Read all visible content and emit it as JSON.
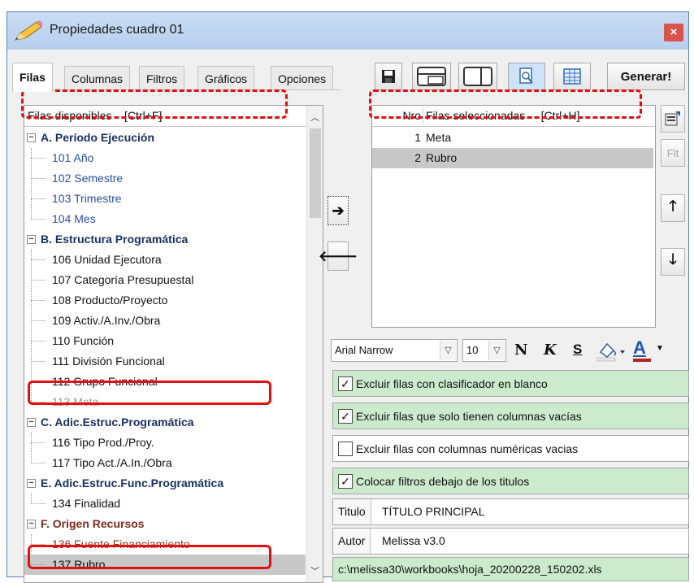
{
  "window": {
    "title": "Propiedades cuadro 01",
    "close_glyph": "×"
  },
  "tabs": [
    {
      "label": "Filas",
      "active": true
    },
    {
      "label": "Columnas",
      "active": false
    },
    {
      "label": "Filtros",
      "active": false
    },
    {
      "label": "Gráficos",
      "active": false
    },
    {
      "label": "Opciones",
      "active": false
    }
  ],
  "toolbar": {
    "icons": [
      "save-icon",
      "layout-rows-icon",
      "layout-columns-icon",
      "preview-icon",
      "grid-icon"
    ],
    "generate_label": "Generar!"
  },
  "available": {
    "header": "Filas disponibles    [Ctrl+F]",
    "groups": [
      {
        "label": "A. Período Ejecución",
        "color": "#17305f",
        "items": [
          "101 Año",
          "102 Semestre",
          "103 Trimestre",
          "104 Mes"
        ]
      },
      {
        "label": "B. Estructura Programática",
        "color": "#17305f",
        "items": [
          "106 Unidad Ejecutora",
          "107 Categoría Presupuestal",
          "108 Producto/Proyecto",
          "109 Activ./A.Inv./Obra",
          "110 Función",
          "111 División Funcional",
          "112 Grupo Funcional",
          "113 Meta"
        ]
      },
      {
        "label": "C. Adic.Estruc.Programática",
        "color": "#17305f",
        "items": [
          "116 Tipo Prod./Proy.",
          "117 Tipo Act./A.In./Obra"
        ]
      },
      {
        "label": "E. Adic.Estruc.Func.Programática",
        "color": "#17305f",
        "items": [
          "134 Finalidad"
        ]
      },
      {
        "label": "F. Origen Recursos",
        "color": "#7d2c1a",
        "items": [
          "136 Fuente Financiamiento",
          "137 Rubro"
        ]
      }
    ]
  },
  "selected": {
    "col_nro": "Nro",
    "header": "Filas seleccionadas     [Ctrl+H]",
    "rows": [
      {
        "nro": "1",
        "name": "Meta"
      },
      {
        "nro": "2",
        "name": "Rubro"
      }
    ],
    "filter_label": "Flt"
  },
  "move": {
    "add_glyph": "➔",
    "remove_glyph": "🡐"
  },
  "order": {
    "up_glyph": "🡑",
    "down_glyph": "🡓"
  },
  "font": {
    "family": "Arial Narrow",
    "size": "10",
    "bold": "N",
    "italic": "K",
    "strike": "S",
    "color_glyph": "A"
  },
  "options": [
    {
      "label": "Excluir filas con clasificador en blanco",
      "checked": true
    },
    {
      "label": "Excluir filas que solo tienen columnas vacías",
      "checked": true
    },
    {
      "label": "Excluir filas con columnas numéricas vacias",
      "checked": false
    },
    {
      "label": "Colocar filtros debajo de los titulos",
      "checked": true
    }
  ],
  "fields": {
    "titulo_label": "Titulo",
    "titulo_value": "TÍTULO PRINCIPAL",
    "autor_label": "Autor",
    "autor_value": "Melissa v3.0",
    "path": "c:\\melissa30\\workbooks\\hoja_20200228_150202.xls"
  },
  "colors": {
    "accent_red": "#e01010",
    "option_green": "#ccebcd",
    "highlight": "#c8c8c8"
  }
}
